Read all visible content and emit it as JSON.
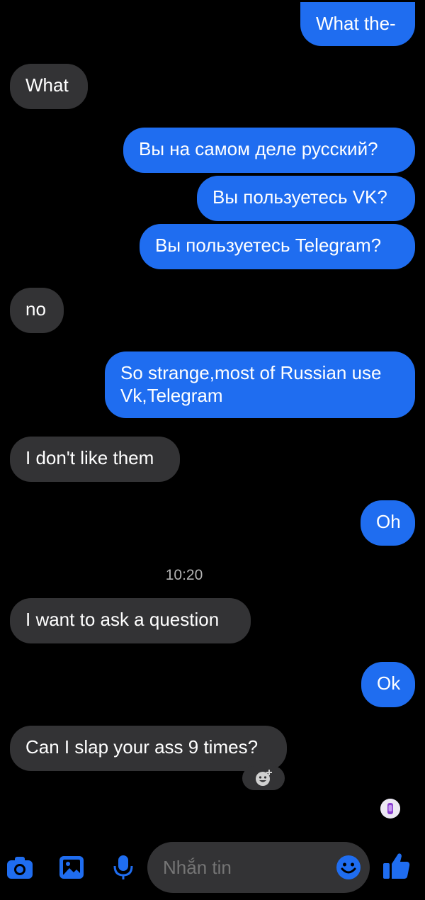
{
  "conversation": {
    "messages": [
      {
        "side": "out",
        "text": "What the-"
      },
      {
        "side": "in",
        "text": "What"
      },
      {
        "side": "out",
        "text": "Вы на самом деле русский?"
      },
      {
        "side": "out",
        "text": "Вы пользуетесь VK?"
      },
      {
        "side": "out",
        "text": "Вы пользуетесь Telegram?"
      },
      {
        "side": "in",
        "text": "no"
      },
      {
        "side": "out",
        "text": "So strange,most of Russian use\nVk,Telegram"
      },
      {
        "side": "in",
        "text": "I don't like them"
      },
      {
        "side": "out",
        "text": "Oh"
      },
      {
        "side": "in",
        "text": "I want to ask a question"
      },
      {
        "side": "out",
        "text": "Ok"
      },
      {
        "side": "in",
        "text": "Can I slap your ass 9 times?"
      }
    ],
    "timestamp": "10:20"
  },
  "composer": {
    "placeholder": "Nhắn tin",
    "icons": {
      "camera": "camera-icon",
      "gallery": "gallery-icon",
      "mic": "microphone-icon",
      "emoji": "emoji-icon",
      "like": "thumbs-up-icon"
    }
  },
  "colors": {
    "outgoing_bubble": "#1f6df0",
    "incoming_bubble": "#333335",
    "accent": "#1f6df0",
    "background": "#000000"
  }
}
